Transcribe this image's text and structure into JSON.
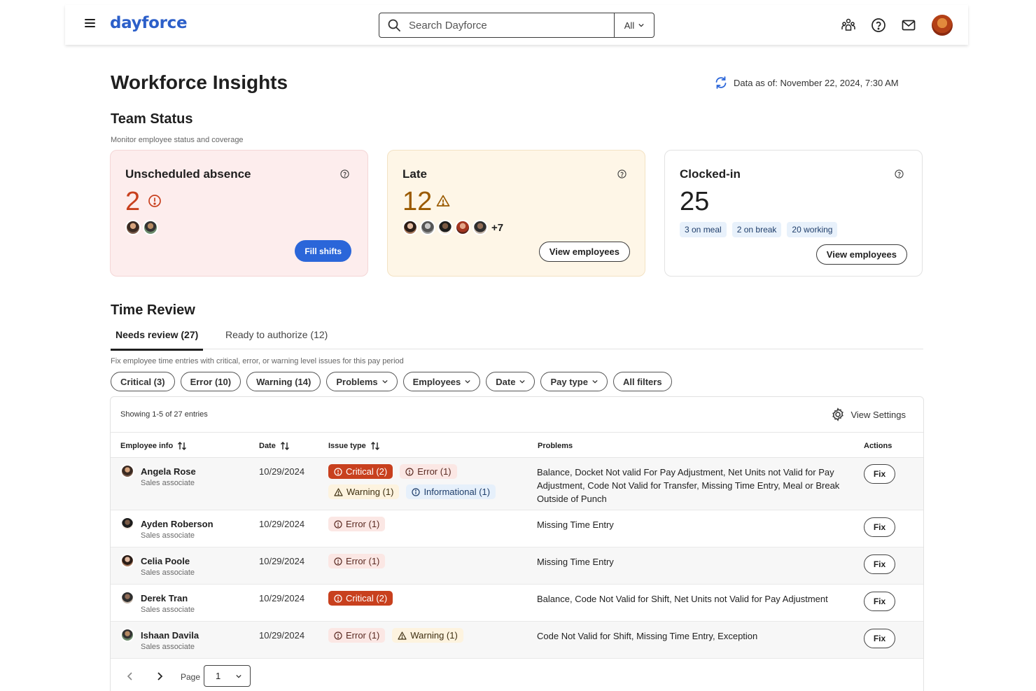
{
  "header": {
    "brand": "dayforce",
    "search_placeholder": "Search Dayforce",
    "search_scope": "All",
    "icons": [
      "menu-icon",
      "team-icon",
      "help-icon",
      "mail-icon",
      "user-avatar"
    ]
  },
  "page": {
    "title": "Workforce Insights",
    "data_as_of": "Data as of: November 22, 2024, 7:30 AM"
  },
  "team_status": {
    "title": "Team Status",
    "subtitle": "Monitor employee status and coverage",
    "cards": {
      "absence": {
        "title": "Unscheduled absence",
        "count": "2",
        "button": "Fill shifts"
      },
      "late": {
        "title": "Late",
        "count": "12",
        "more": "+7",
        "button": "View employees"
      },
      "clocked": {
        "title": "Clocked-in",
        "count": "25",
        "chips": [
          "3 on meal",
          "2 on break",
          "20 working"
        ],
        "button": "View employees"
      }
    }
  },
  "time_review": {
    "title": "Time Review",
    "tabs": {
      "needs_review": "Needs review (27)",
      "ready": "Ready to authorize (12)"
    },
    "description": "Fix employee time entries with critical, error, or warning level issues for this pay period",
    "filters": {
      "critical": "Critical (3)",
      "error": "Error (10)",
      "warning": "Warning (14)",
      "problems": "Problems",
      "employees": "Employees",
      "date": "Date",
      "pay_type": "Pay type",
      "all_filters": "All filters"
    },
    "showing": "Showing 1-5 of 27 entries",
    "view_settings": "View Settings",
    "columns": {
      "employee": "Employee info",
      "date": "Date",
      "issue": "Issue type",
      "problems": "Problems",
      "actions": "Actions"
    },
    "rows": [
      {
        "name": "Angela Rose",
        "role": "Sales associate",
        "date": "10/29/2024",
        "badges": {
          "critical": "Critical (2)",
          "error": "Error (1)",
          "warning": "Warning (1)",
          "info": "Informational (1)"
        },
        "problems": "Balance, Docket Not valid For Pay Adjustment, Net Units not Valid for Pay Adjustment, Code Not Valid for Transfer, Missing Time Entry, Meal or Break Outside of Punch",
        "action": "Fix"
      },
      {
        "name": "Ayden Roberson",
        "role": "Sales associate",
        "date": "10/29/2024",
        "badges": {
          "error": "Error (1)"
        },
        "problems": "Missing Time Entry",
        "action": "Fix"
      },
      {
        "name": "Celia Poole",
        "role": "Sales associate",
        "date": "10/29/2024",
        "badges": {
          "error": "Error (1)"
        },
        "problems": "Missing Time Entry",
        "action": "Fix"
      },
      {
        "name": "Derek Tran",
        "role": "Sales associate",
        "date": "10/29/2024",
        "badges": {
          "critical": "Critical (2)"
        },
        "problems": "Balance, Code Not Valid for Shift, Net Units not Valid for Pay Adjustment",
        "action": "Fix"
      },
      {
        "name": "Ishaan Davila",
        "role": "Sales associate",
        "date": "10/29/2024",
        "badges": {
          "error": "Error (1)",
          "warning": "Warning (1)"
        },
        "problems": "Code Not Valid for Shift, Missing Time Entry, Exception",
        "action": "Fix"
      }
    ],
    "pager": {
      "label": "Page",
      "value": "1"
    }
  },
  "colors": {
    "brand": "#2c5fc9",
    "primary_button": "#2b66d9",
    "critical": "#c8401e",
    "absence_bg": "#fdeded",
    "late_bg": "#fef6e7"
  }
}
